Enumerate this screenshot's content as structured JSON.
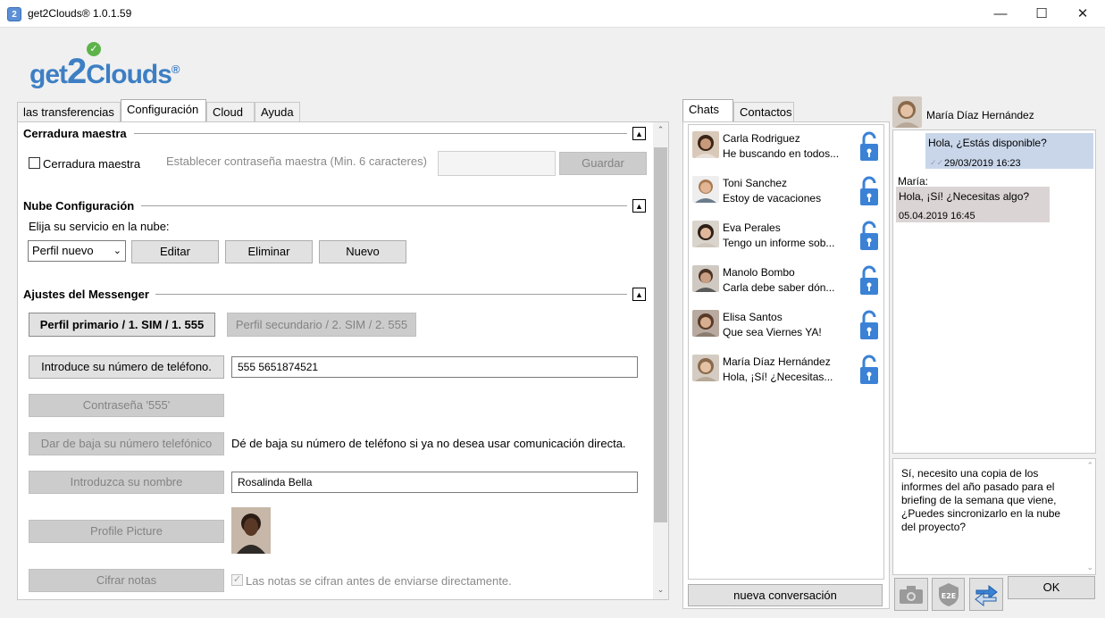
{
  "window": {
    "title": "get2Clouds® 1.0.1.59",
    "app_icon": "2"
  },
  "logo": {
    "part1": "get",
    "part2": "2",
    "part3": "Clouds",
    "reg": "®"
  },
  "tabs": [
    {
      "label": "las transferencias"
    },
    {
      "label": "Configuración"
    },
    {
      "label": "Cloud"
    },
    {
      "label": "Ayuda"
    }
  ],
  "master_lock": {
    "title": "Cerradura maestra",
    "checkbox_label": "Cerradura maestra",
    "password_hint": "Establecer contraseña maestra (Min. 6 caracteres)",
    "password_value": "",
    "save_label": "Guardar"
  },
  "cloud_config": {
    "title": "Nube Configuración",
    "prompt": "Elija su servicio en la nube:",
    "profile_selected": "Perfil nuevo",
    "edit_label": "Editar",
    "delete_label": "Eliminar",
    "new_label": "Nuevo"
  },
  "messenger": {
    "title": "Ajustes del Messenger",
    "primary_profile": "Perfil primario / 1. SIM / 1. 555",
    "secondary_profile": "Perfil secundario / 2. SIM / 2. 555",
    "phone_button": "Introduce su número de teléfono.",
    "phone_value": "555 5651874521",
    "password_button": "Contraseña '555'",
    "unsubscribe_button": "Dar de baja su número telefónico",
    "unsubscribe_text": "Dé de baja su número de teléfono si ya no desea usar comunicación directa.",
    "name_button": "Introduzca su nombre",
    "name_value": "Rosalinda Bella",
    "picture_button": "Profile Picture",
    "encrypt_button": "Cifrar notas",
    "encrypt_text": "Las notas se cifran antes de enviarse directamente."
  },
  "side_tabs": [
    {
      "label": "Chats"
    },
    {
      "label": "Contactos"
    }
  ],
  "chats": [
    {
      "name": "Carla Rodriguez",
      "preview": "He buscando en todos..."
    },
    {
      "name": "Toni Sanchez",
      "preview": "Estoy de vacaciones"
    },
    {
      "name": "Eva Perales",
      "preview": "Tengo un informe sob..."
    },
    {
      "name": "Manolo Bombo",
      "preview": "Carla debe saber dón..."
    },
    {
      "name": "Elisa Santos",
      "preview": "Que sea Viernes YA!"
    },
    {
      "name": "María Díaz Hernández",
      "preview": "Hola, ¡Sí! ¿Necesitas..."
    }
  ],
  "new_chat_label": "nueva conversación",
  "conversation": {
    "contact_name": "María Díaz Hernández",
    "messages": [
      {
        "text": "Hola, ¿Estás disponible?",
        "time": "29/03/2019 16:23"
      },
      {
        "sender": "María:",
        "text": "Hola, ¡Sí! ¿Necesitas algo?",
        "time": "05.04.2019 16:45"
      }
    ],
    "compose_lines": [
      "Sí, necesito una copia de los",
      "informes del año pasado para el",
      "briefing de la semana que viene,",
      "¿Puedes sincronizarlo en la nube",
      "del proyecto?"
    ],
    "e2e_label": "E2E",
    "ok_label": "OK"
  },
  "colors": {
    "outgoing_bubble": "#c9d6ea",
    "incoming_bubble": "#dbd4d4",
    "lock_blue": "#3b82d6",
    "logo_blue": "#3d7fc4"
  }
}
